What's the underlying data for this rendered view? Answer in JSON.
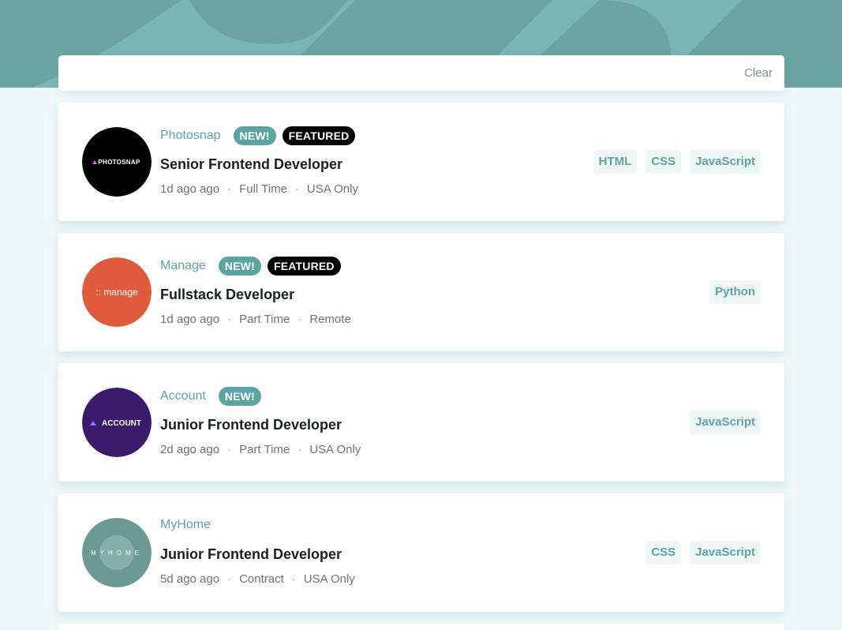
{
  "filter": {
    "clear_label": "Clear"
  },
  "colors": {
    "primary": "#5ba4a4",
    "banner": "#79b5b6",
    "background": "#eff7f8",
    "tag_background": "#eff6f6",
    "featured": "#000000"
  },
  "jobs": [
    {
      "company": "Photosnap",
      "logo_text": "PHOTOSNAP",
      "logo_color": "#000000",
      "new_label": "NEW!",
      "featured_label": "FEATURED",
      "position": "Senior Frontend Developer",
      "posted": "1d ago ago",
      "contract": "Full Time",
      "location": "USA Only",
      "tags": [
        "HTML",
        "CSS",
        "JavaScript"
      ]
    },
    {
      "company": "Manage",
      "logo_text": ":: manage",
      "logo_color": "#e05e3f",
      "new_label": "NEW!",
      "featured_label": "FEATURED",
      "position": "Fullstack Developer",
      "posted": "1d ago ago",
      "contract": "Part Time",
      "location": "Remote",
      "tags": [
        "Python"
      ]
    },
    {
      "company": "Account",
      "logo_text": "ACCOUNT",
      "logo_color": "#3d1d6e",
      "new_label": "NEW!",
      "position": "Junior Frontend Developer",
      "posted": "2d ago ago",
      "contract": "Part Time",
      "location": "USA Only",
      "tags": [
        "JavaScript"
      ]
    },
    {
      "company": "MyHome",
      "logo_text": "MYHOME",
      "logo_color": "#6f9a97",
      "position": "Junior Frontend Developer",
      "posted": "5d ago ago",
      "contract": "Contract",
      "location": "USA Only",
      "tags": [
        "CSS",
        "JavaScript"
      ]
    }
  ],
  "separator": "·"
}
